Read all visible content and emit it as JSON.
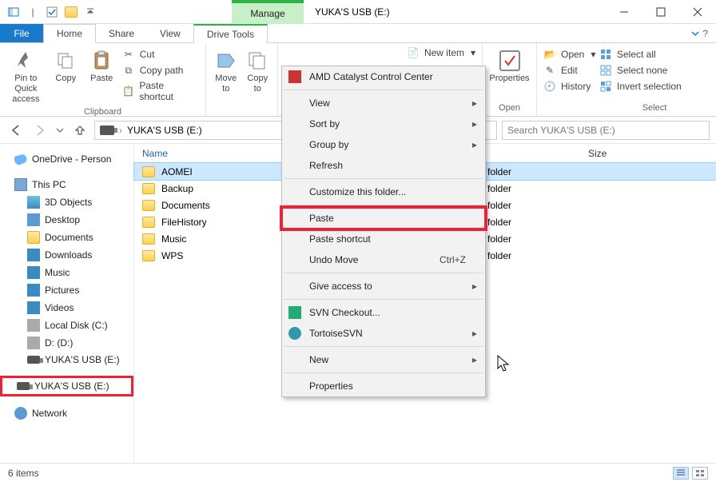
{
  "window": {
    "title": "YUKA'S USB (E:)",
    "manage_label": "Manage"
  },
  "tabs": {
    "file": "File",
    "home": "Home",
    "share": "Share",
    "view": "View",
    "drive_tools": "Drive Tools"
  },
  "ribbon": {
    "pin": "Pin to Quick\naccess",
    "copy": "Copy",
    "paste": "Paste",
    "cut": "Cut",
    "copy_path": "Copy path",
    "paste_shortcut": "Paste shortcut",
    "clipboard": "Clipboard",
    "move_to": "Move\nto",
    "copy_to": "Copy\nto",
    "new_item": "New item",
    "properties": "Properties",
    "open": "Open",
    "edit": "Edit",
    "history": "History",
    "open_group": "Open",
    "select_all": "Select all",
    "select_none": "Select none",
    "invert": "Invert selection",
    "select_group": "Select"
  },
  "address": {
    "path": "YUKA'S USB (E:)",
    "search_placeholder": "Search YUKA'S USB (E:)"
  },
  "columns": {
    "name": "Name",
    "size": "Size"
  },
  "tree": {
    "onedrive": "OneDrive - Person",
    "thispc": "This PC",
    "objects3d": "3D Objects",
    "desktop": "Desktop",
    "documents": "Documents",
    "downloads": "Downloads",
    "music": "Music",
    "pictures": "Pictures",
    "videos": "Videos",
    "localc": "Local Disk (C:)",
    "dd": "D: (D:)",
    "yuka1": "YUKA'S USB (E:)",
    "yuka2": "YUKA'S USB (E:)",
    "network": "Network"
  },
  "files": [
    {
      "name": "AOMEI",
      "type": "folder"
    },
    {
      "name": "Backup",
      "type": "folder"
    },
    {
      "name": "Documents",
      "type": "folder"
    },
    {
      "name": "FileHistory",
      "type": "folder"
    },
    {
      "name": "Music",
      "type": "folder"
    },
    {
      "name": "WPS",
      "type": "folder"
    }
  ],
  "file_type_label": "folder",
  "context": {
    "amd": "AMD Catalyst Control Center",
    "view": "View",
    "sort": "Sort by",
    "group": "Group by",
    "refresh": "Refresh",
    "customize": "Customize this folder...",
    "paste": "Paste",
    "paste_shortcut": "Paste shortcut",
    "undo": "Undo Move",
    "undo_key": "Ctrl+Z",
    "give_access": "Give access to",
    "svn": "SVN Checkout...",
    "tortoise": "TortoiseSVN",
    "new": "New",
    "properties": "Properties"
  },
  "status": {
    "items": "6 items"
  }
}
